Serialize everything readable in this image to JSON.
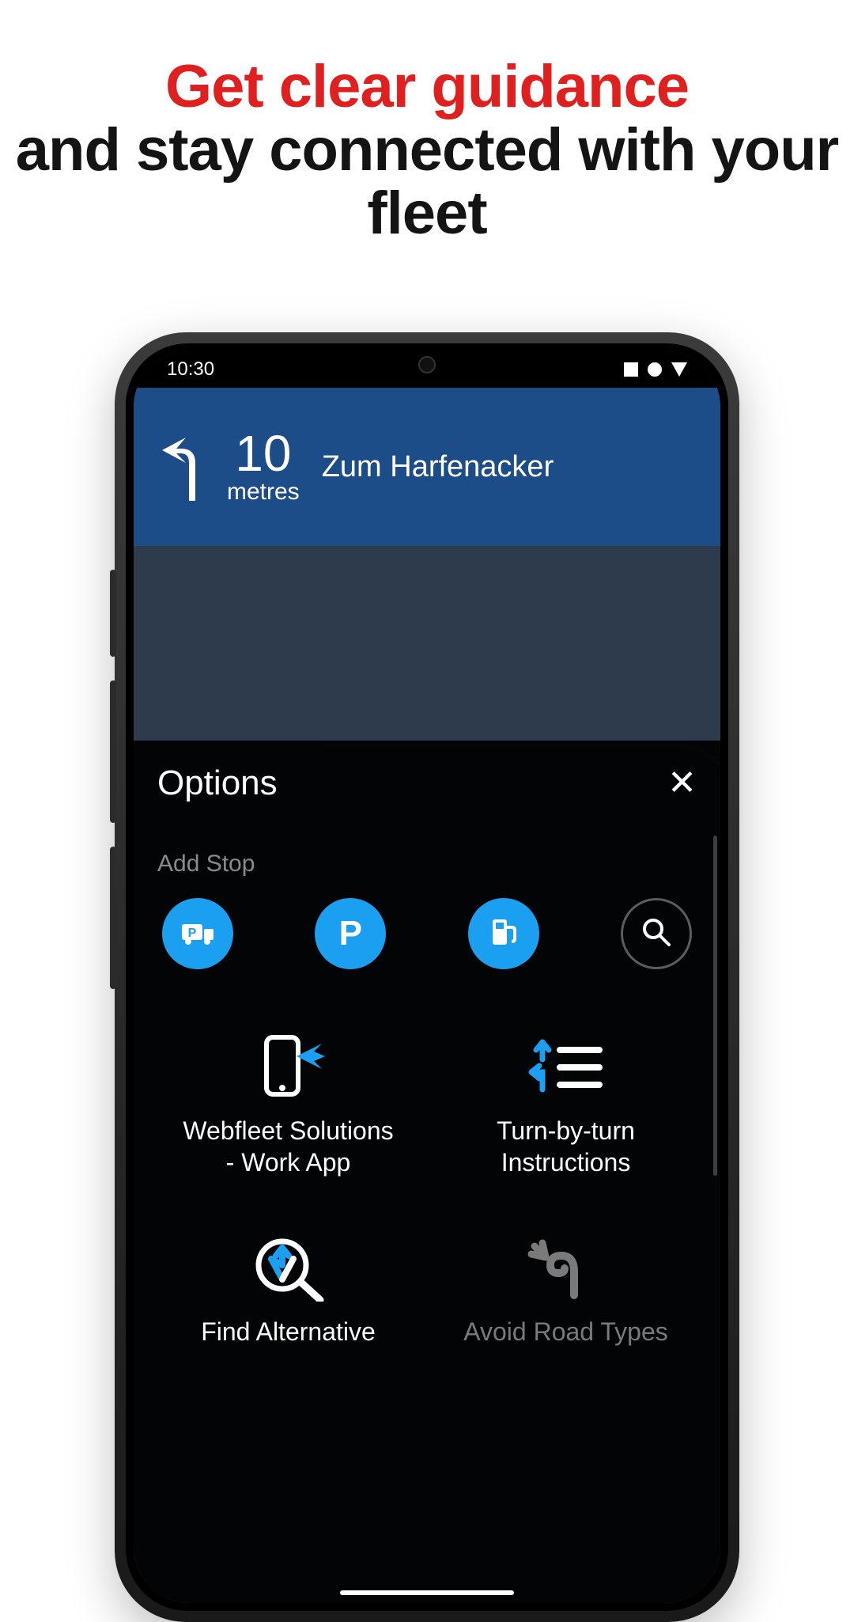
{
  "headline": {
    "line1": "Get clear guidance",
    "line2": "and stay connected with your fleet"
  },
  "statusbar": {
    "time": "10:30"
  },
  "nav": {
    "distance_value": "10",
    "distance_unit": "metres",
    "street": "Zum Harfenacker"
  },
  "options": {
    "title": "Options",
    "add_stop_label": "Add Stop",
    "stop_buttons": [
      {
        "id": "truck-parking",
        "icon": "truck-parking-icon"
      },
      {
        "id": "parking",
        "icon": "parking-icon"
      },
      {
        "id": "fuel",
        "icon": "fuel-icon"
      },
      {
        "id": "search",
        "icon": "search-icon"
      }
    ],
    "tiles": [
      {
        "id": "webfleet",
        "label": "Webfleet Solutions - Work App",
        "dim": false
      },
      {
        "id": "turnby",
        "label": "Turn-by-turn Instructions",
        "dim": false
      },
      {
        "id": "findalt",
        "label": "Find Alternative",
        "dim": false
      },
      {
        "id": "avoidroad",
        "label": "Avoid Road Types",
        "dim": true
      }
    ]
  }
}
